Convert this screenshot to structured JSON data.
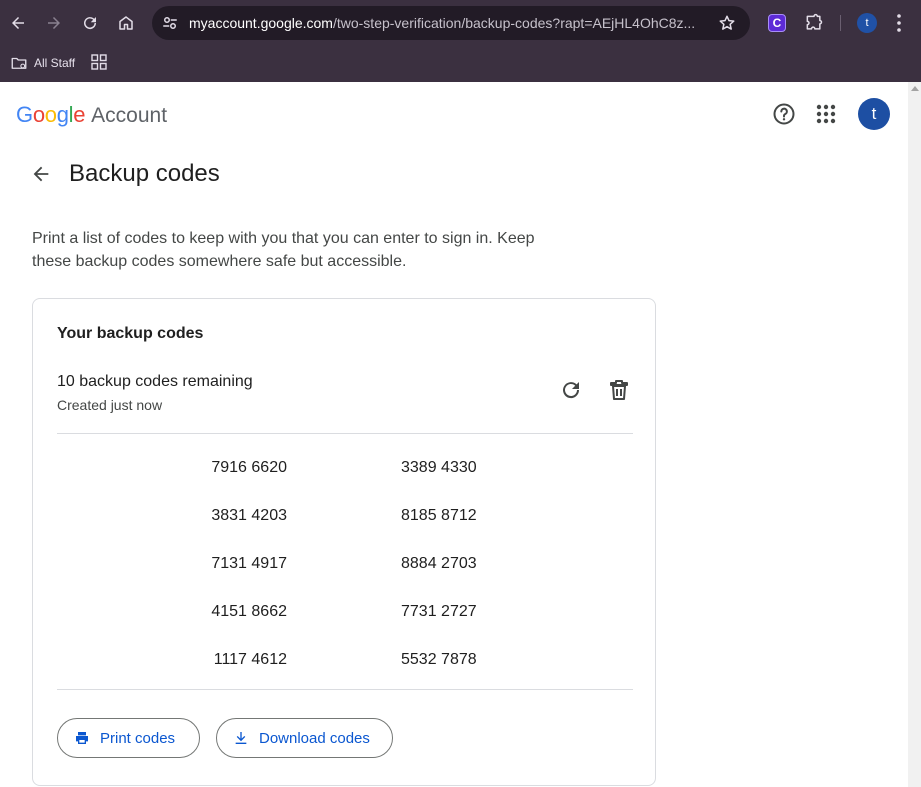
{
  "browser": {
    "url_host": "myaccount.google.com",
    "url_path": "/two-step-verification/backup-codes?rapt=AEjHL4OhC8z...",
    "extension_letter": "C",
    "profile_letter": "t",
    "bookmark_label": "All Staff"
  },
  "header": {
    "logo_letters": [
      "G",
      "o",
      "o",
      "g",
      "l",
      "e"
    ],
    "account_word": "Account",
    "avatar_letter": "t"
  },
  "page": {
    "title": "Backup codes",
    "description": "Print a list of codes to keep with you that you can enter to sign in. Keep these backup codes somewhere safe but accessible."
  },
  "card": {
    "title": "Your backup codes",
    "remaining": "10 backup codes remaining",
    "created": "Created just now",
    "codes_left": [
      "7916 6620",
      "3831 4203",
      "7131 4917",
      "4151 8662",
      "1117 4612"
    ],
    "codes_right": [
      "3389 4330",
      "8185 8712",
      "8884 2703",
      "7731 2727",
      "5532 7878"
    ],
    "print_label": "Print codes",
    "download_label": "Download codes"
  },
  "colors": {
    "chrome_bg": "#3b3040",
    "accent_blue": "#0b57d0",
    "avatar_bg": "#1d4fa3"
  },
  "icons": [
    "back-arrow-icon",
    "forward-arrow-icon",
    "reload-icon",
    "home-icon",
    "tune-icon",
    "star-icon",
    "puzzle-icon",
    "more-vert-icon",
    "folder-icon",
    "apps-grid-icon",
    "help-icon",
    "arrow-back-icon",
    "refresh-icon",
    "delete-icon",
    "print-icon",
    "download-icon"
  ]
}
